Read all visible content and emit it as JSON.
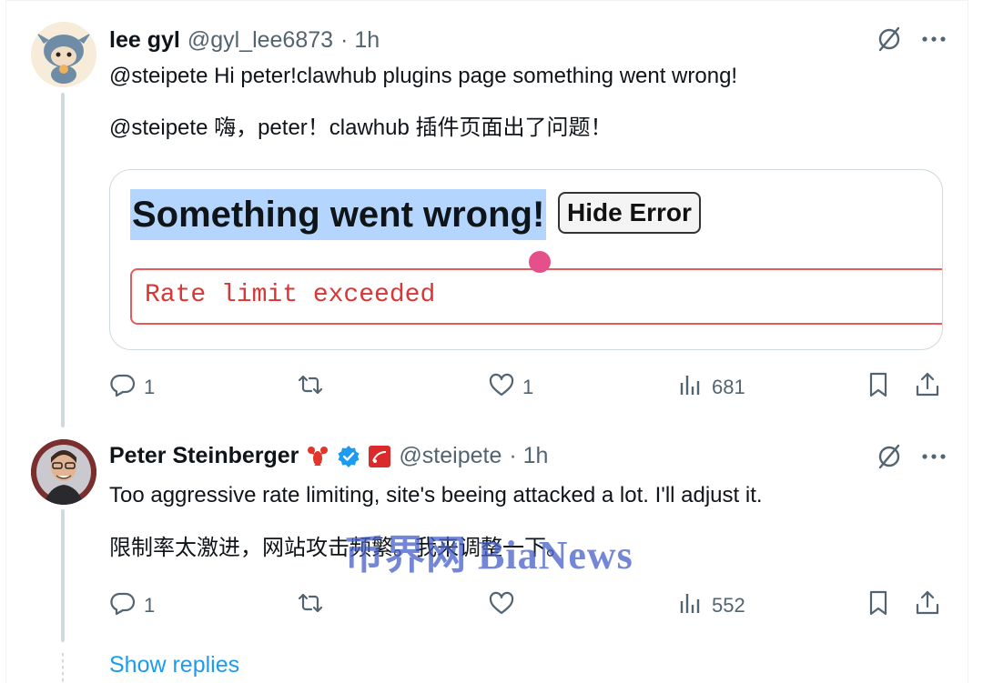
{
  "tweet1": {
    "name": "lee gyl",
    "handle": "@gyl_lee6873",
    "time": "· 1h",
    "text_en": "@steipete  Hi peter!clawhub plugins page something went wrong!",
    "text_zh": "@steipete 嗨，peter！clawhub 插件页面出了问题！",
    "media": {
      "heading": "Something went wrong!",
      "button": "Hide Error",
      "error_message": "Rate limit exceeded"
    },
    "stats": {
      "replies": "1",
      "reposts": "",
      "likes": "1",
      "views": "681"
    }
  },
  "tweet2": {
    "name": "Peter Steinberger",
    "handle": "@steipete",
    "time": "· 1h",
    "text_en": "Too aggressive rate limiting, site's beeing attacked a lot. I'll adjust it.",
    "text_zh": "限制率太激进，网站攻击频繁。我来调整一下。",
    "stats": {
      "replies": "1",
      "reposts": "",
      "likes": "",
      "views": "552"
    }
  },
  "show_replies": "Show replies",
  "watermark": "币界网 BiaNews",
  "colors": {
    "accent": "#1d9bf0",
    "verified": "#1d9bf0",
    "muted": "#536471",
    "error": "#d93636"
  },
  "icons": [
    "grok-icon",
    "more-icon",
    "reply-icon",
    "repost-icon",
    "like-icon",
    "views-icon",
    "bookmark-icon",
    "share-icon",
    "lobster-emoji-icon",
    "verified-badge-icon",
    "affiliate-badge-icon"
  ]
}
